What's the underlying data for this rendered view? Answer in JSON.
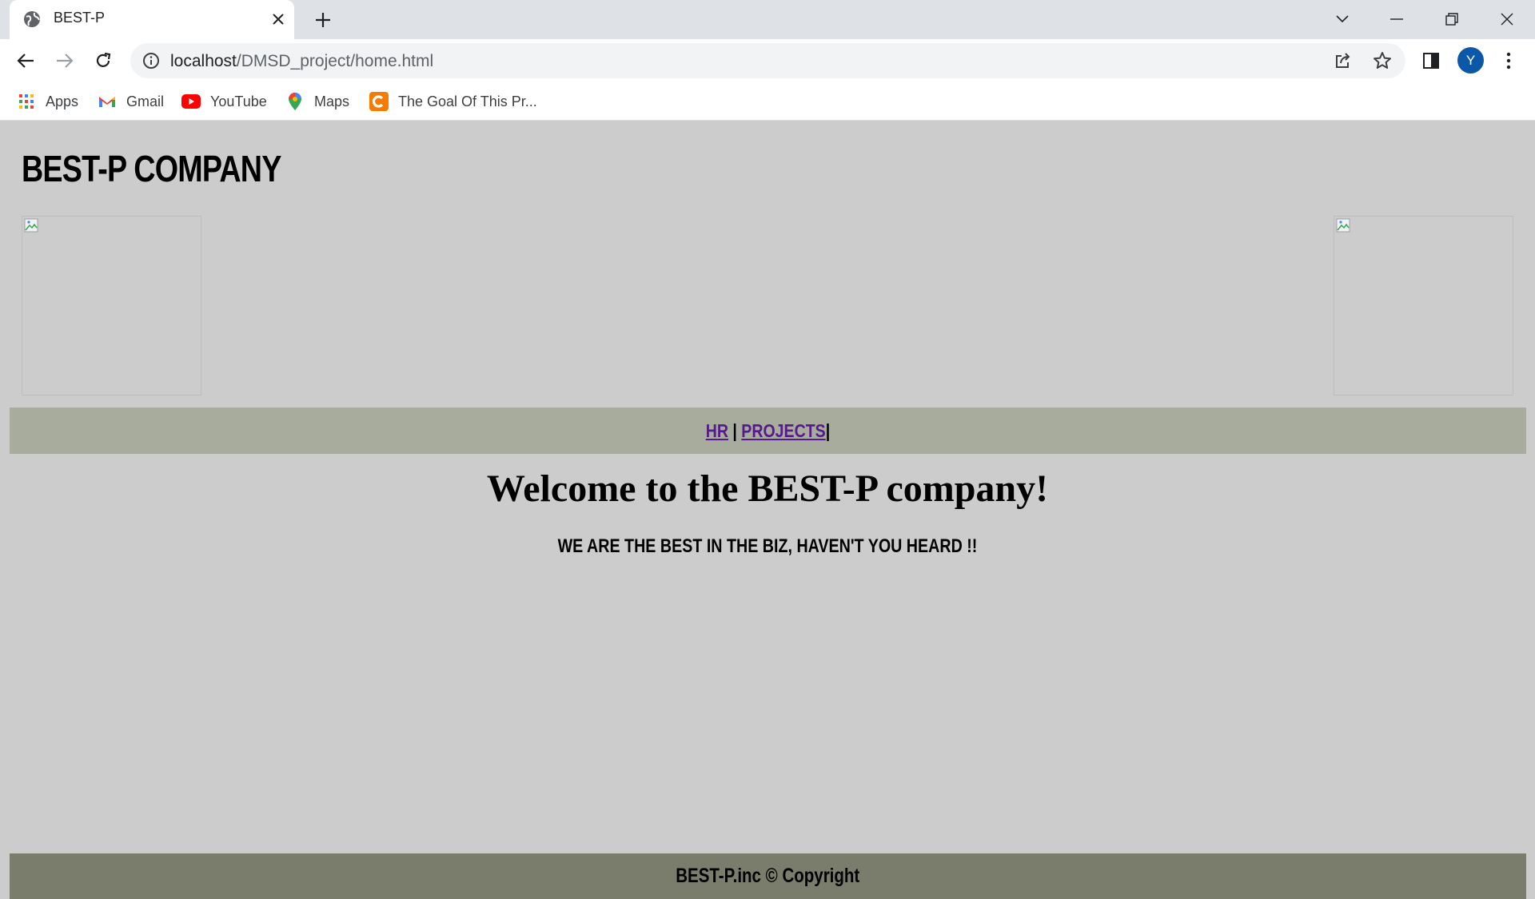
{
  "browser": {
    "tab": {
      "title": "BEST-P",
      "favicon": "globe-icon",
      "close_icon": "close-icon"
    },
    "new_tab_icon": "plus-icon",
    "window_controls": [
      "chevron-down-icon",
      "minimize-icon",
      "restore-icon",
      "close-icon"
    ],
    "address_bar": {
      "host": "localhost",
      "path": "/DMSD_project/home.html",
      "info_icon": "info-icon"
    },
    "profile_initial": "Y",
    "bookmarks": [
      {
        "label": "Apps",
        "icon": "apps-grid-icon"
      },
      {
        "label": "Gmail",
        "icon": "gmail-icon"
      },
      {
        "label": "YouTube",
        "icon": "youtube-icon"
      },
      {
        "label": "Maps",
        "icon": "maps-pin-icon"
      },
      {
        "label": "The Goal Of This Pr...",
        "icon": "c-logo-icon"
      }
    ]
  },
  "page": {
    "company_title": "BEST-P COMPANY",
    "nav": {
      "hr_label": "HR",
      "separator": " | ",
      "projects_label": "PROJECTS",
      "trailing_separator": "|"
    },
    "welcome": "Welcome to the BEST-P company!",
    "tagline": "WE ARE THE BEST IN THE BIZ, HAVEN'T YOU HEARD !!",
    "footer": "BEST-P.inc © Copyright"
  },
  "colors": {
    "page_background": "#cccccc",
    "nav_background": "#a8ac9c",
    "footer_background": "#7a7d6c",
    "link": "#551a8b",
    "avatar": "#0b57a8"
  }
}
